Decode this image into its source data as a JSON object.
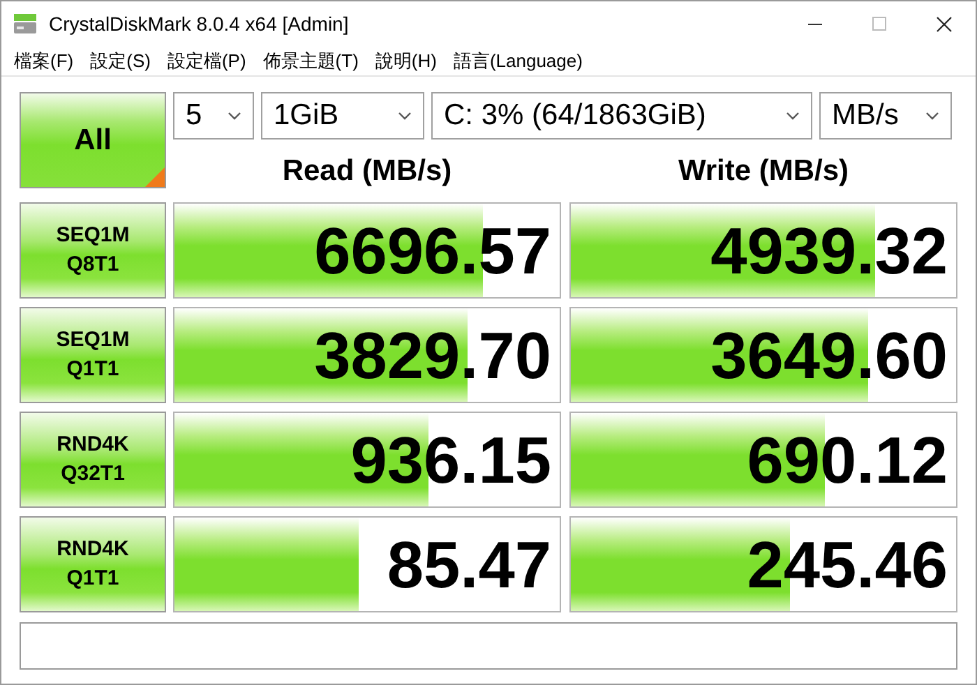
{
  "window": {
    "title": "CrystalDiskMark 8.0.4 x64 [Admin]"
  },
  "menu": [
    "檔案(F)",
    "設定(S)",
    "設定檔(P)",
    "佈景主題(T)",
    "說明(H)",
    "語言(Language)"
  ],
  "all_button": {
    "label": "All"
  },
  "selectors": [
    {
      "value": "5"
    },
    {
      "value": "1GiB"
    },
    {
      "value": "C: 3% (64/1863GiB)"
    },
    {
      "value": "MB/s"
    }
  ],
  "headers": {
    "read": "Read (MB/s)",
    "write": "Write (MB/s)"
  },
  "tests": [
    {
      "line1": "SEQ1M",
      "line2": "Q8T1",
      "read": {
        "value": "6696.57",
        "level": 0.8
      },
      "write": {
        "value": "4939.32",
        "level": 0.79
      }
    },
    {
      "line1": "SEQ1M",
      "line2": "Q1T1",
      "read": {
        "value": "3829.70",
        "level": 0.76
      },
      "write": {
        "value": "3649.60",
        "level": 0.77
      }
    },
    {
      "line1": "RND4K",
      "line2": "Q32T1",
      "read": {
        "value": "936.15",
        "level": 0.66
      },
      "write": {
        "value": "690.12",
        "level": 0.66
      }
    },
    {
      "line1": "RND4K",
      "line2": "Q1T1",
      "read": {
        "value": "85.47",
        "level": 0.48
      },
      "write": {
        "value": "245.46",
        "level": 0.57
      }
    }
  ]
}
